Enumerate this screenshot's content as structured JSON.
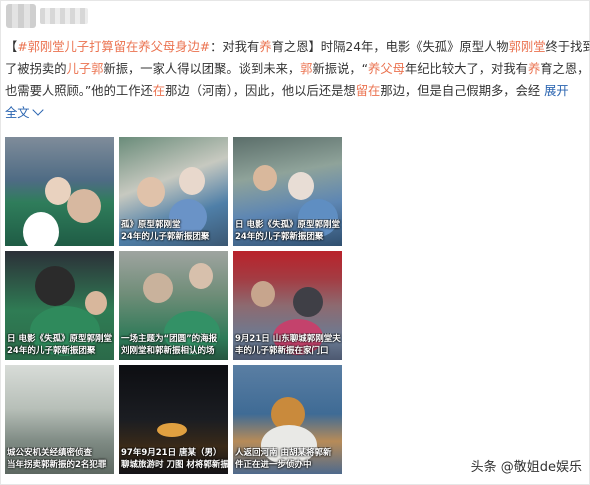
{
  "post": {
    "lines": [
      [
        {
          "text": "【",
          "style": "t"
        },
        {
          "text": "#郭刚堂儿子打算留在养父母身边#",
          "style": "tag"
        },
        {
          "text": "：对我有",
          "style": "t"
        },
        {
          "text": "养",
          "style": "hl"
        },
        {
          "text": "育之恩】时隔24年，电影《失孤》原型人物",
          "style": "t"
        },
        {
          "text": "郭刚堂",
          "style": "link"
        },
        {
          "text": "终于找到",
          "style": "t"
        }
      ],
      [
        {
          "text": "了被拐卖的",
          "style": "t"
        },
        {
          "text": "儿子郭",
          "style": "hl"
        },
        {
          "text": "新振，一家人得以团聚。谈到未来，",
          "style": "t"
        },
        {
          "text": "郭",
          "style": "hl"
        },
        {
          "text": "新振说，“",
          "style": "t"
        },
        {
          "text": "养父母",
          "style": "hl"
        },
        {
          "text": "年纪比较大了，对我有",
          "style": "t"
        },
        {
          "text": "养",
          "style": "hl"
        },
        {
          "text": "育之恩，",
          "style": "t"
        }
      ],
      [
        {
          "text": "也需要人照顾。”他的工作还",
          "style": "t"
        },
        {
          "text": "在",
          "style": "hl"
        },
        {
          "text": "那边（河南），因此，他以后还是想",
          "style": "t"
        },
        {
          "text": "留在",
          "style": "hl"
        },
        {
          "text": "那边，但是自己假期多，会经",
          "style": "t"
        },
        {
          "text": "  展开",
          "style": "more"
        }
      ],
      [
        {
          "text": "全文",
          "style": "more"
        }
      ]
    ]
  },
  "images": [
    {
      "caption": "",
      "name": "photo-embrace-police"
    },
    {
      "caption": "孤》原型郭刚堂",
      "caption2": "24年的儿子郭新振团聚",
      "name": "photo-embrace-elder"
    },
    {
      "caption": "日 电影《失孤》原型郭刚堂",
      "caption2": "24年的儿子郭新振团聚",
      "name": "photo-reunion-crowd"
    },
    {
      "caption": "日 电影《失孤》原型郭刚堂",
      "caption2": "24年的儿子郭新振团聚",
      "name": "photo-hug-green-shirt"
    },
    {
      "caption": "一场主题为“团圆”的海报",
      "caption2": "刘刚堂和郭新振相认的场",
      "name": "photo-reunion-poster"
    },
    {
      "caption": "9月21日 山东聊城郭刚堂夫",
      "caption2": "丰的儿子郭新振在家门口",
      "name": "photo-family-doorstep"
    },
    {
      "caption": "城公安机关经缜密侦查",
      "caption2": "当年拐卖郭新振的2名犯罪",
      "name": "photo-rainy-road"
    },
    {
      "caption": "97年9月21日 唐某（男）",
      "caption2": "聊城旅游时 刀图 材将郭新振",
      "name": "photo-night-car"
    },
    {
      "caption": "人返回河南 由胡某将郭新",
      "caption2": "件正在进一步侦办中",
      "name": "photo-interrogation"
    }
  ],
  "watermark": "头条 @敬姐de娱乐"
}
